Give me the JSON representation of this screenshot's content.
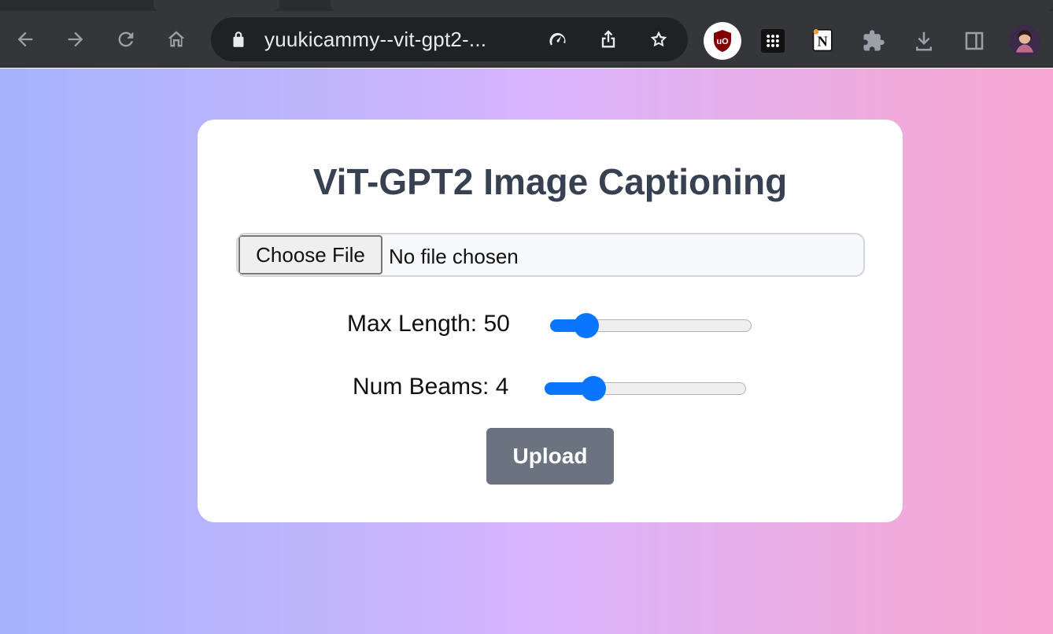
{
  "browser": {
    "url": "yuukicammy--vit-gpt2-...",
    "extensions": [
      "ublock-origin",
      "apps-grid",
      "notion",
      "extensions-puzzle",
      "downloads",
      "side-panel",
      "profile-avatar"
    ]
  },
  "app": {
    "title": "ViT-GPT2 Image Captioning",
    "file_input": {
      "button_label": "Choose File",
      "status": "No file chosen"
    },
    "sliders": [
      {
        "label": "Max Length: 50",
        "value": 50,
        "fraction": 0.13
      },
      {
        "label": "Num Beams: 4",
        "value": 4,
        "fraction": 0.2
      }
    ],
    "upload_label": "Upload"
  },
  "colors": {
    "accent": "#0a75ff",
    "button": "#6b7280",
    "title": "#374151",
    "gradient_start": "#a5b4fc",
    "gradient_end": "#f9a8d4"
  }
}
